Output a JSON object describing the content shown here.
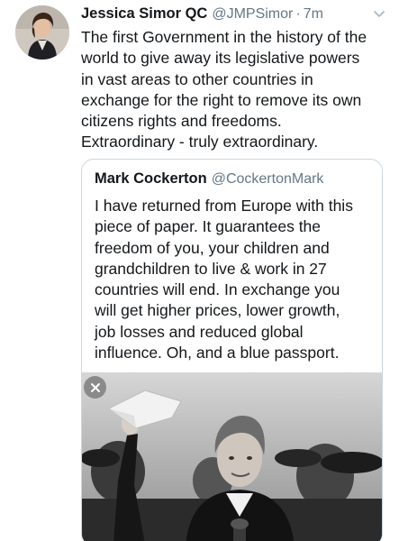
{
  "tweet": {
    "display_name": "Jessica Simor QC",
    "handle": "@JMPSimor",
    "separator": "·",
    "time": "7m",
    "text": "The first Government in the history of the\nworld to give away its legislative powers\nin vast areas to other countries in\nexchange for the right to remove its own\ncitizens rights and freedoms.\nExtraordinary - truly extraordinary.",
    "menu_icon": "chevron-down-icon"
  },
  "quoted_tweet": {
    "display_name": "Mark Cockerton",
    "handle": "@CockertonMark",
    "text": "I have returned from Europe with this\npiece of paper. It guarantees the\nfreedom of you, your children and\ngrandchildren to live & work in 27\ncountries will end. In exchange you\nwill get higher prices, lower growth,\njob losses and reduced global\ninfluence. Oh, and a blue passport.",
    "media_close_icon": "close-icon"
  },
  "colors": {
    "text": "#14171a",
    "secondary_text": "#657786",
    "border": "#ccd6dd"
  }
}
